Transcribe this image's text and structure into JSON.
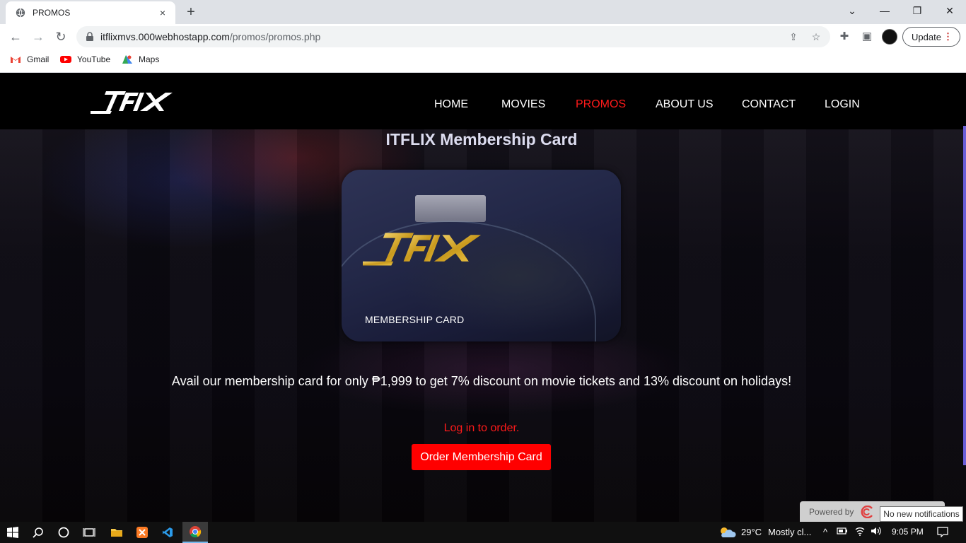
{
  "browser": {
    "tab": {
      "title": "PROMOS",
      "close_icon": "×"
    },
    "new_tab_icon": "+",
    "window_controls": {
      "chevron": "⌄",
      "minimize": "—",
      "restore": "❐",
      "close": "✕"
    },
    "nav": {
      "back": "←",
      "forward": "→",
      "reload": "↻"
    },
    "url": {
      "host": "itflixmvs.000webhostapp.com",
      "path": "/promos/promos.php"
    },
    "toolbar_icons": {
      "share": "⇪",
      "star": "☆",
      "extensions": "✚",
      "side_panel": "▣",
      "menu": "⋮"
    },
    "update_label": "Update",
    "bookmarks": [
      {
        "label": "Gmail",
        "icon": "gmail-icon"
      },
      {
        "label": "YouTube",
        "icon": "youtube-icon"
      },
      {
        "label": "Maps",
        "icon": "maps-icon"
      }
    ]
  },
  "site": {
    "nav": [
      {
        "label": "HOME",
        "active": false
      },
      {
        "label": "MOVIES",
        "active": false
      },
      {
        "label": "PROMOS",
        "active": true
      },
      {
        "label": "ABOUT US",
        "active": false
      },
      {
        "label": "CONTACT",
        "active": false
      },
      {
        "label": "LOGIN",
        "active": false
      }
    ],
    "accent_color": "#ff0000",
    "promo": {
      "title": "ITFLIX Membership Card",
      "card_label": "MEMBERSHIP CARD",
      "description": "Avail our membership card for only ₱1,999 to get 7% discount on movie tickets and 13% discount on holidays!",
      "login_note": "Log in to order.",
      "order_button": "Order Membership Card"
    },
    "powered_by": "Powered by",
    "notification_tooltip": "No new notifications"
  },
  "taskbar": {
    "weather_temp": "29°C",
    "weather_desc": "Mostly cl...",
    "time": "9:05 PM",
    "apps": [
      "windows-start-icon",
      "search-icon",
      "cortana-icon",
      "task-view-icon",
      "file-explorer-icon",
      "xampp-icon",
      "vscode-icon",
      "chrome-icon"
    ]
  }
}
